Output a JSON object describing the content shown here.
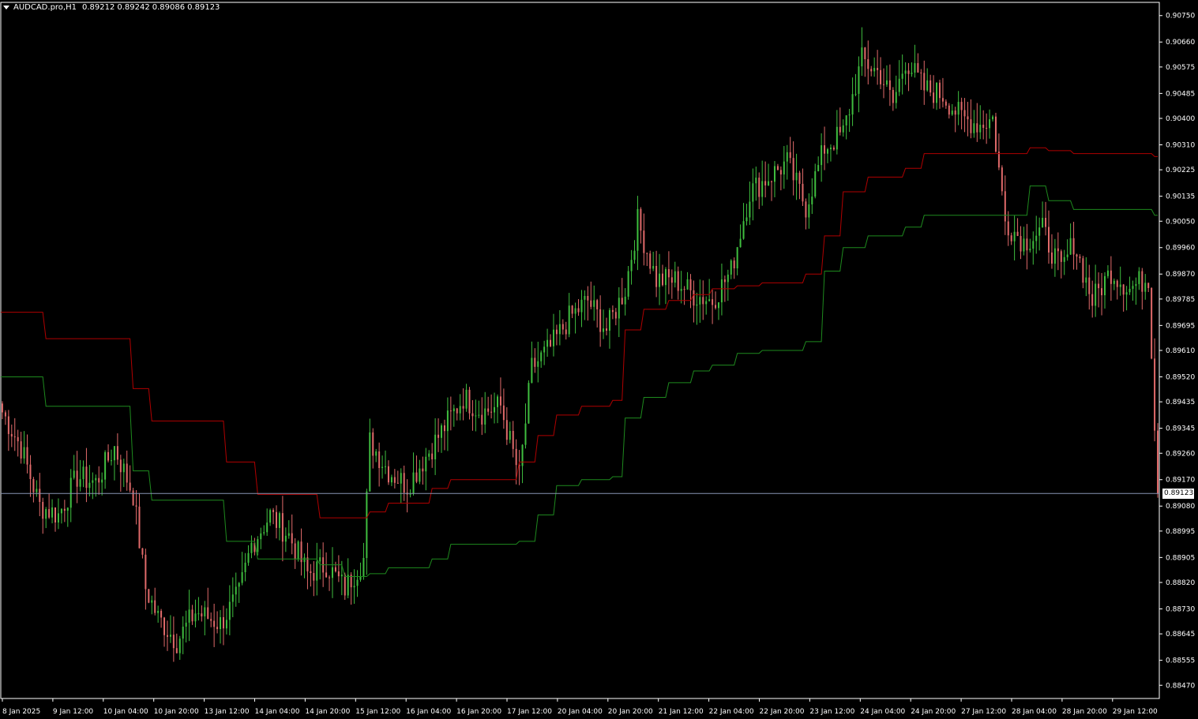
{
  "header": {
    "symbol": "AUDCAD.pro,H1",
    "open": "0.89212",
    "high": "0.89242",
    "low": "0.89086",
    "close": "0.89123"
  },
  "current_price": {
    "label": "0.89123",
    "value": 0.89123
  },
  "colors": {
    "background": "#000000",
    "axis": "#ffffff",
    "bull": "#3fbe3f",
    "bear": "#e06a6a",
    "upper_band": "#b00000",
    "lower_band": "#1e8a1e",
    "price_line": "#8894b4"
  },
  "chart_data": {
    "type": "candlestick",
    "timeframe": "H1",
    "ylim": [
      0.88425,
      0.90795
    ],
    "y_ticks": [
      "0.90750",
      "0.90660",
      "0.90575",
      "0.90485",
      "0.90400",
      "0.90310",
      "0.90225",
      "0.90135",
      "0.90050",
      "0.89960",
      "0.89870",
      "0.89785",
      "0.89695",
      "0.89610",
      "0.89520",
      "0.89435",
      "0.89345",
      "0.89260",
      "0.89170",
      "0.89080",
      "0.88995",
      "0.88905",
      "0.88820",
      "0.88730",
      "0.88645",
      "0.88555",
      "0.88470"
    ],
    "x_ticks": [
      "8 Jan 2025",
      "9 Jan 12:00",
      "10 Jan 04:00",
      "10 Jan 20:00",
      "13 Jan 12:00",
      "14 Jan 04:00",
      "14 Jan 20:00",
      "15 Jan 12:00",
      "16 Jan 04:00",
      "16 Jan 20:00",
      "17 Jan 12:00",
      "20 Jan 04:00",
      "20 Jan 20:00",
      "21 Jan 12:00",
      "22 Jan 04:00",
      "22 Jan 20:00",
      "23 Jan 12:00",
      "24 Jan 04:00",
      "24 Jan 20:00",
      "27 Jan 12:00",
      "28 Jan 04:00",
      "28 Jan 20:00",
      "29 Jan 12:00"
    ],
    "close_anchors": [
      [
        0,
        0.894
      ],
      [
        6,
        0.8928
      ],
      [
        12,
        0.8908
      ],
      [
        18,
        0.8905
      ],
      [
        24,
        0.8918
      ],
      [
        30,
        0.8916
      ],
      [
        36,
        0.8928
      ],
      [
        42,
        0.8912
      ],
      [
        46,
        0.888
      ],
      [
        50,
        0.887
      ],
      [
        56,
        0.8862
      ],
      [
        62,
        0.8872
      ],
      [
        70,
        0.8868
      ],
      [
        76,
        0.8878
      ],
      [
        80,
        0.8895
      ],
      [
        86,
        0.8905
      ],
      [
        92,
        0.8898
      ],
      [
        98,
        0.8885
      ],
      [
        104,
        0.8888
      ],
      [
        110,
        0.888
      ],
      [
        116,
        0.889
      ],
      [
        118,
        0.893
      ],
      [
        124,
        0.892
      ],
      [
        130,
        0.8915
      ],
      [
        136,
        0.8925
      ],
      [
        142,
        0.8935
      ],
      [
        148,
        0.8945
      ],
      [
        154,
        0.894
      ],
      [
        160,
        0.8942
      ],
      [
        166,
        0.8918
      ],
      [
        170,
        0.8955
      ],
      [
        176,
        0.8962
      ],
      [
        182,
        0.8972
      ],
      [
        188,
        0.8978
      ],
      [
        194,
        0.8968
      ],
      [
        200,
        0.8982
      ],
      [
        204,
        0.9005
      ],
      [
        210,
        0.8985
      ],
      [
        216,
        0.8985
      ],
      [
        222,
        0.898
      ],
      [
        228,
        0.8978
      ],
      [
        234,
        0.8988
      ],
      [
        240,
        0.9015
      ],
      [
        246,
        0.902
      ],
      [
        252,
        0.9025
      ],
      [
        258,
        0.901
      ],
      [
        264,
        0.903
      ],
      [
        270,
        0.9035
      ],
      [
        276,
        0.906
      ],
      [
        282,
        0.9055
      ],
      [
        286,
        0.9045
      ],
      [
        290,
        0.906
      ],
      [
        296,
        0.905
      ],
      [
        302,
        0.9048
      ],
      [
        308,
        0.904
      ],
      [
        314,
        0.9038
      ],
      [
        318,
        0.904
      ],
      [
        322,
        0.9005
      ],
      [
        328,
        0.8998
      ],
      [
        334,
        0.9002
      ],
      [
        340,
        0.8988
      ],
      [
        344,
        0.8998
      ],
      [
        350,
        0.8978
      ],
      [
        356,
        0.8988
      ],
      [
        362,
        0.8982
      ],
      [
        368,
        0.8986
      ],
      [
        371,
        0.89123
      ]
    ],
    "upper_band_steps": [
      [
        0,
        0.8974
      ],
      [
        14,
        0.8965
      ],
      [
        42,
        0.8948
      ],
      [
        48,
        0.8937
      ],
      [
        72,
        0.8923
      ],
      [
        82,
        0.8912
      ],
      [
        102,
        0.8904
      ],
      [
        110,
        0.8904
      ],
      [
        118,
        0.8906
      ],
      [
        124,
        0.8909
      ],
      [
        138,
        0.8914
      ],
      [
        144,
        0.8917
      ],
      [
        166,
        0.8923
      ],
      [
        172,
        0.8932
      ],
      [
        178,
        0.8939
      ],
      [
        186,
        0.8942
      ],
      [
        196,
        0.8944
      ],
      [
        200,
        0.8968
      ],
      [
        206,
        0.8975
      ],
      [
        214,
        0.8978
      ],
      [
        222,
        0.898
      ],
      [
        228,
        0.8982
      ],
      [
        236,
        0.8983
      ],
      [
        244,
        0.8984
      ],
      [
        258,
        0.8987
      ],
      [
        264,
        0.9
      ],
      [
        270,
        0.9015
      ],
      [
        278,
        0.902
      ],
      [
        290,
        0.9023
      ],
      [
        296,
        0.9028
      ],
      [
        330,
        0.903
      ],
      [
        336,
        0.9029
      ],
      [
        344,
        0.9028
      ],
      [
        370,
        0.9027
      ]
    ],
    "lower_band_steps": [
      [
        0,
        0.8952
      ],
      [
        14,
        0.8942
      ],
      [
        42,
        0.892
      ],
      [
        48,
        0.891
      ],
      [
        72,
        0.8896
      ],
      [
        82,
        0.889
      ],
      [
        102,
        0.8888
      ],
      [
        110,
        0.8884
      ],
      [
        118,
        0.8885
      ],
      [
        124,
        0.8887
      ],
      [
        138,
        0.889
      ],
      [
        144,
        0.8895
      ],
      [
        166,
        0.8896
      ],
      [
        172,
        0.8905
      ],
      [
        178,
        0.8915
      ],
      [
        186,
        0.8917
      ],
      [
        196,
        0.8918
      ],
      [
        200,
        0.8938
      ],
      [
        206,
        0.8945
      ],
      [
        214,
        0.895
      ],
      [
        222,
        0.8954
      ],
      [
        228,
        0.8956
      ],
      [
        236,
        0.896
      ],
      [
        244,
        0.8961
      ],
      [
        258,
        0.8964
      ],
      [
        264,
        0.8988
      ],
      [
        270,
        0.8996
      ],
      [
        278,
        0.9
      ],
      [
        290,
        0.9003
      ],
      [
        296,
        0.9007
      ],
      [
        330,
        0.9017
      ],
      [
        336,
        0.9012
      ],
      [
        344,
        0.9009
      ],
      [
        370,
        0.9007
      ]
    ]
  }
}
